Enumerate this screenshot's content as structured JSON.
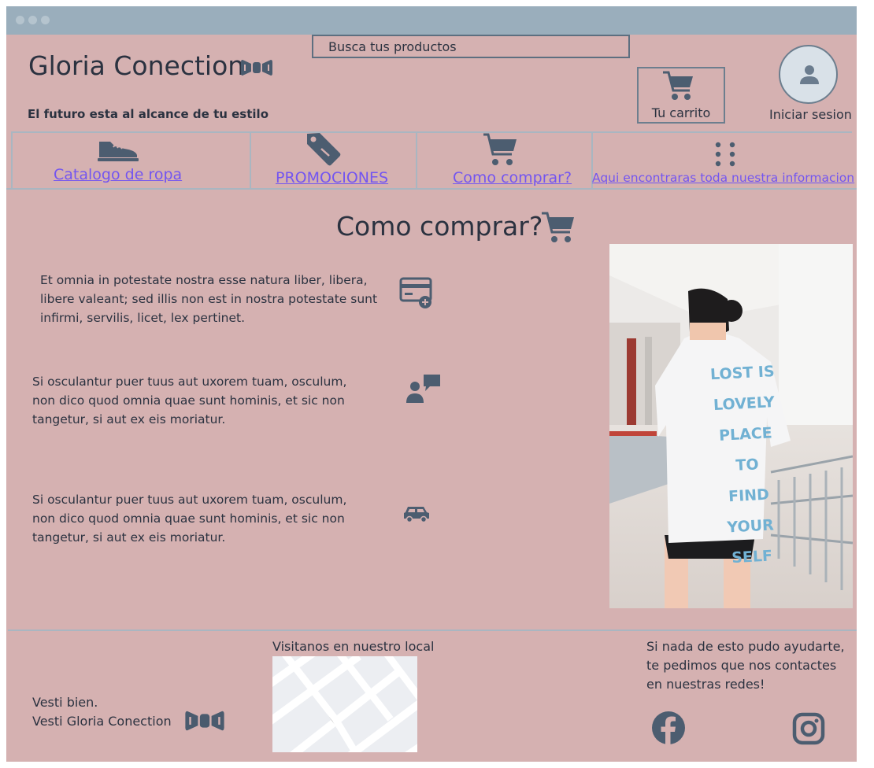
{
  "app": {
    "brand_name": "Gloria Conection",
    "tagline": "El futuro esta al alcance de tu estilo"
  },
  "header": {
    "search_placeholder": "Busca tus productos",
    "cart_label": "Tu carrito",
    "login_label": "Iniciar sesion"
  },
  "nav": {
    "items": [
      {
        "label": "Catalogo de ropa",
        "icon": "shoe-icon"
      },
      {
        "label": "PROMOCIONES",
        "icon": "tag-icon"
      },
      {
        "label": "Como comprar?",
        "icon": "cart-icon"
      },
      {
        "label": "Aqui  encontraras toda nuestra informacion",
        "icon": "dots-grid-icon"
      }
    ]
  },
  "main": {
    "heading": "Como comprar?",
    "steps": [
      {
        "text": "Et omnia in potestate nostra esse natura liber, libera, libere valeant; sed illis non est in nostra potestate sunt infirmi, servilis, licet, lex pertinet.",
        "icon": "add-card-icon"
      },
      {
        "text": "Si osculantur puer tuus aut uxorem tuam, osculum, non dico quod omnia quae sunt hominis, et sic non tangetur, si aut ex eis moriatur.",
        "icon": "person-chat-icon"
      },
      {
        "text": "Si osculantur puer tuus aut uxorem tuam, osculum, non dico quod omnia quae sunt hominis, et sic non tangetur, si aut ex eis moriatur.",
        "icon": "car-icon"
      }
    ],
    "photo_shirt_text": [
      "LOST IS",
      "LOVELY",
      "PLACE TO",
      "FIND YOUR",
      "SELF"
    ]
  },
  "footer": {
    "slogan_line1": "Vesti bien.",
    "slogan_line2": "Vesti Gloria Conection",
    "visit_label": "Visitanos en nuestro local",
    "contact_text": "Si nada de esto pudo ayudarte, te pedimos que nos contactes en nuestras redes!",
    "socials": [
      "facebook-icon",
      "instagram-icon"
    ]
  },
  "colors": {
    "page_bg": "#d5b1b1",
    "titlebar": "#9aaebc",
    "icon": "#4c5d70",
    "link": "#7355f0",
    "text": "#2b3240"
  }
}
